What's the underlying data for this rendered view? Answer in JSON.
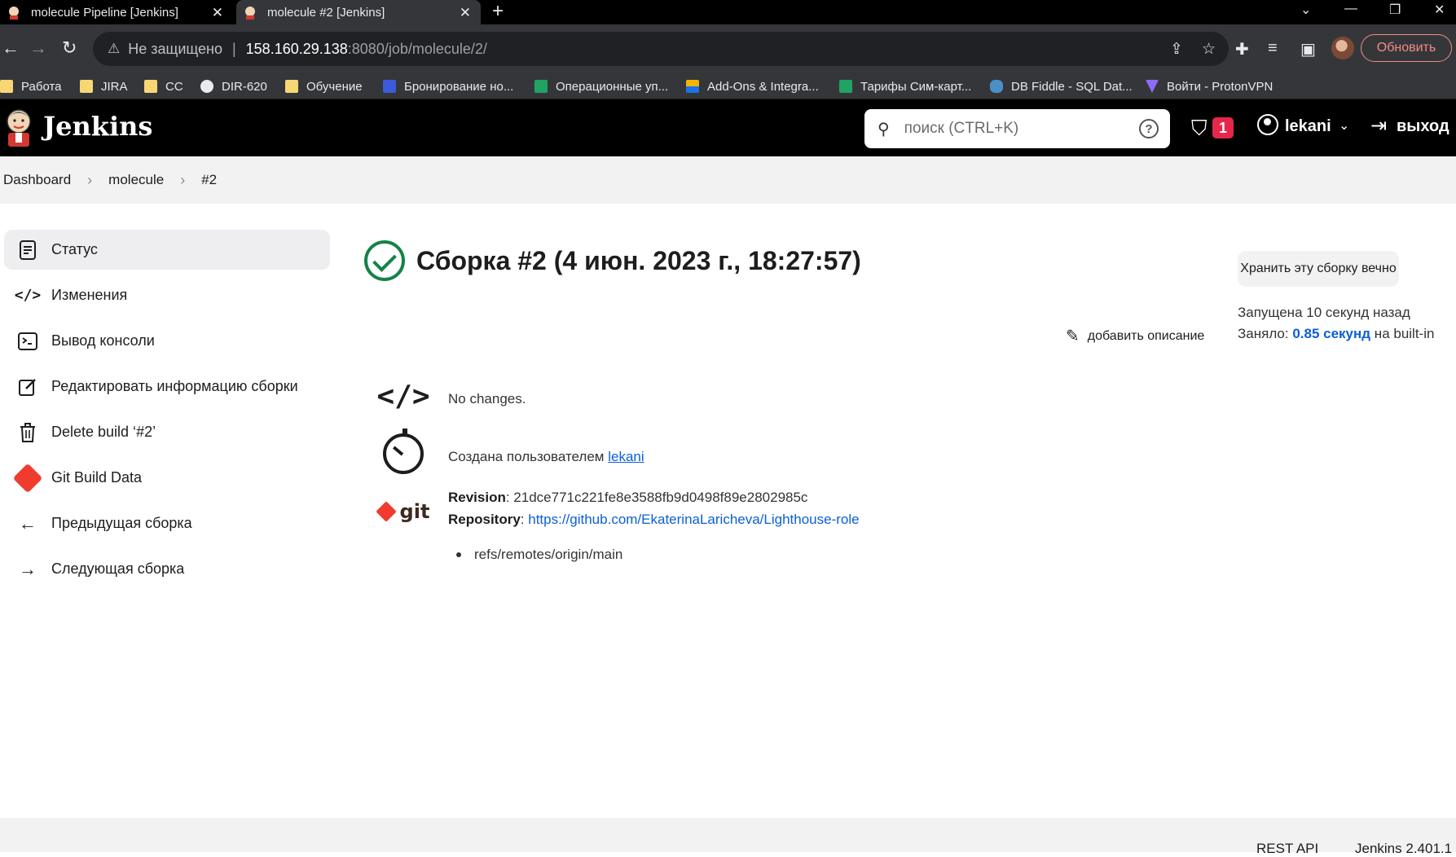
{
  "browser": {
    "tabs": [
      {
        "title": "molecule Pipeline [Jenkins]",
        "active": false
      },
      {
        "title": "molecule #2 [Jenkins]",
        "active": true
      }
    ],
    "new_tab_label": "+",
    "address": {
      "security": "Не защищено",
      "host": "158.160.29.138",
      "path": ":8080/job/molecule/2/"
    },
    "update_label": "Обновить",
    "bookmarks": [
      {
        "label": "Работа",
        "icon": "folder-icon"
      },
      {
        "label": "JIRA",
        "icon": "folder-icon"
      },
      {
        "label": "CC",
        "icon": "folder-icon"
      },
      {
        "label": "DIR-620",
        "icon": "globe-icon"
      },
      {
        "label": "Обучение",
        "icon": "folder-icon"
      },
      {
        "label": "Бронирование но...",
        "icon": "grid-icon"
      },
      {
        "label": "Операционные уп...",
        "icon": "sheets-icon"
      },
      {
        "label": "Add-Ons & Integra...",
        "icon": "stripes-icon"
      },
      {
        "label": "Тарифы Сим-карт...",
        "icon": "sheets-icon"
      },
      {
        "label": "DB Fiddle - SQL Dat...",
        "icon": "database-icon"
      },
      {
        "label": "Войти - ProtonVPN",
        "icon": "vpn-icon"
      }
    ]
  },
  "header": {
    "brand": "Jenkins",
    "search_placeholder": "поиск (CTRL+K)",
    "alerts_count": "1",
    "username": "lekani",
    "logout_label": "выход"
  },
  "breadcrumb": [
    "Dashboard",
    "molecule",
    "#2"
  ],
  "sidebar": {
    "items": [
      {
        "label": "Статус",
        "icon": "document-icon",
        "active": true
      },
      {
        "label": "Изменения",
        "icon": "code-icon"
      },
      {
        "label": "Вывод консоли",
        "icon": "terminal-icon"
      },
      {
        "label": "Редактировать информацию сборки",
        "icon": "edit-icon"
      },
      {
        "label": "Delete build ‘#2’",
        "icon": "trash-icon"
      },
      {
        "label": "Git Build Data",
        "icon": "git-icon"
      },
      {
        "label": "Предыдущая сборка",
        "icon": "arrow-left-icon"
      },
      {
        "label": "Следующая сборка",
        "icon": "arrow-right-icon"
      }
    ]
  },
  "main": {
    "title": "Сборка #2 (4 июн. 2023 г., 18:27:57)",
    "status": "success",
    "keep_label": "Хранить эту сборку вечно",
    "started": "Запущена 10 секунд назад",
    "took_prefix": "Заняло: ",
    "took_value": "0.85 секунд",
    "took_suffix": " на built-in",
    "add_description": "добавить описание",
    "no_changes": "No changes.",
    "created_by_prefix": "Создана пользователем ",
    "created_by_user": "lekani",
    "revision_label": "Revision",
    "revision_value": ": 21dce771c221fe8e3588fb9d0498f89e2802985c",
    "repository_label": "Repository",
    "repository_url": "https://github.com/EkaterinaLaricheva/Lighthouse-role",
    "branch": "refs/remotes/origin/main"
  },
  "footer": {
    "rest_api": "REST API",
    "version": "Jenkins 2.401.1"
  },
  "colors": {
    "success": "#138347",
    "link": "#0b5fd6",
    "alert": "#e6274a",
    "header_bg": "#000000"
  }
}
